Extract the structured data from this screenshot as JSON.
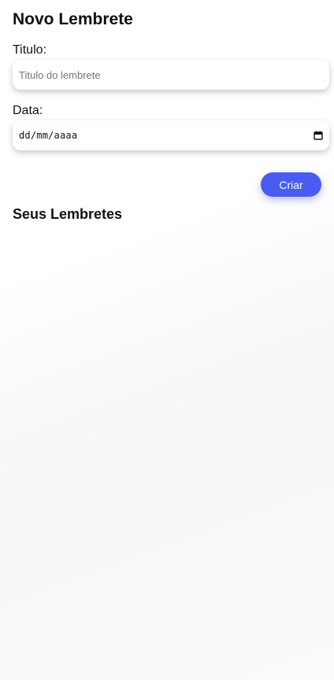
{
  "form": {
    "title": "Novo Lembrete",
    "title_label": "Titulo:",
    "title_placeholder": "Titulo do lembrete",
    "title_value": "",
    "date_label": "Data:",
    "date_placeholder": "dd/mm/aaaa",
    "date_icon": "calendar-icon",
    "submit_label": "Criar"
  },
  "reminders": {
    "title": "Seus Lembretes",
    "items": []
  },
  "colors": {
    "accent": "#4a5bf2",
    "text": "#111111",
    "placeholder": "#757575"
  }
}
